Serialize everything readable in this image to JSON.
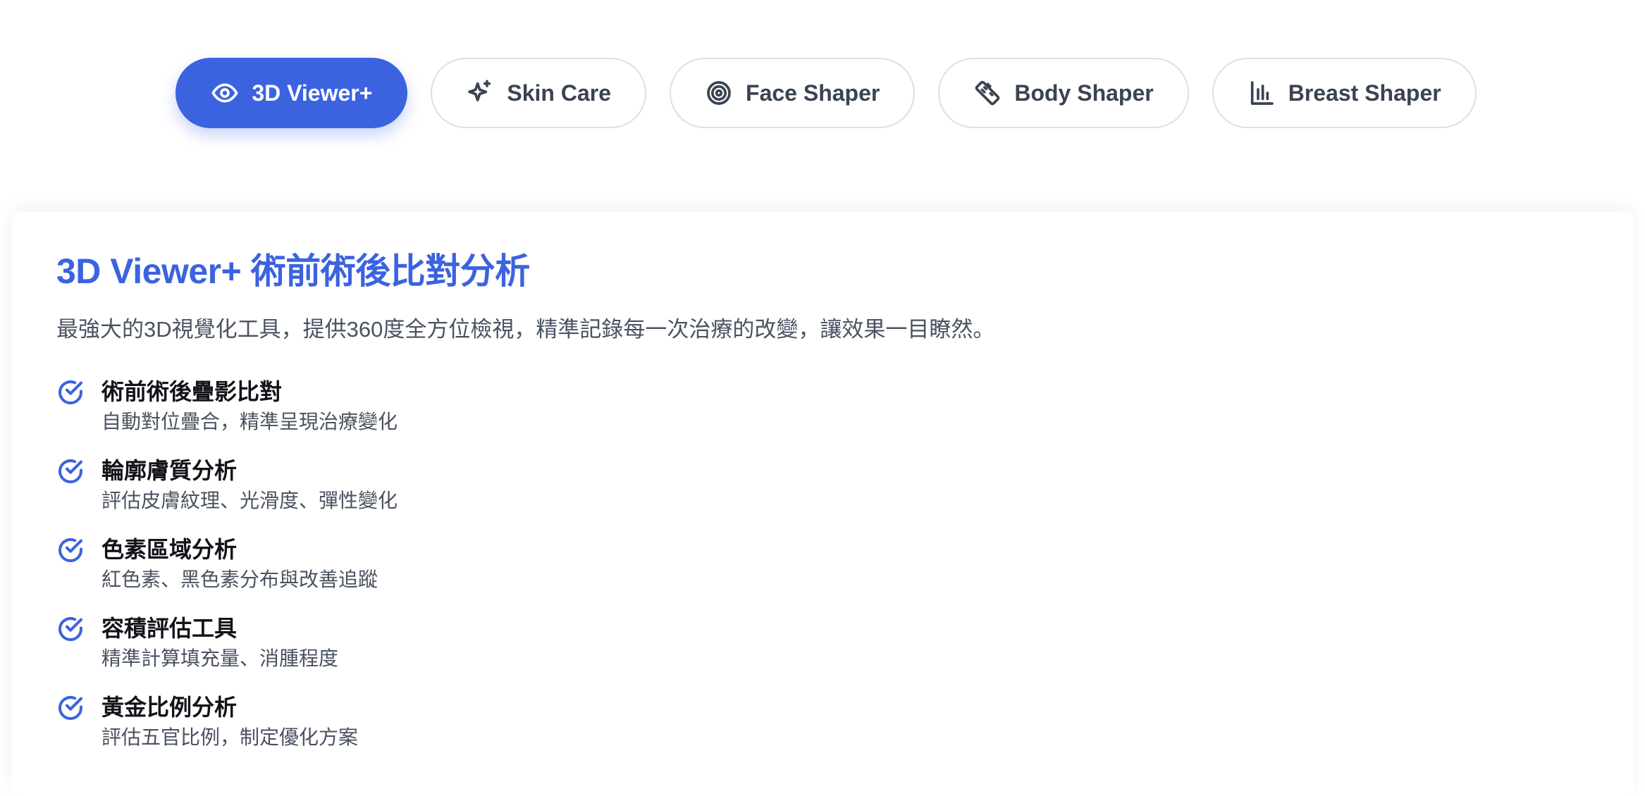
{
  "tabs": [
    {
      "label": "3D Viewer+",
      "icon": "eye-icon",
      "active": true
    },
    {
      "label": "Skin Care",
      "icon": "sparkles-icon",
      "active": false
    },
    {
      "label": "Face Shaper",
      "icon": "target-icon",
      "active": false
    },
    {
      "label": "Body Shaper",
      "icon": "ruler-icon",
      "active": false
    },
    {
      "label": "Breast Shaper",
      "icon": "bar-chart-icon",
      "active": false
    }
  ],
  "panel": {
    "title": "3D Viewer+ 術前術後比對分析",
    "description": "最強大的3D視覺化工具，提供360度全方位檢視，精準記錄每一次治療的改變，讓效果一目瞭然。",
    "features": [
      {
        "title": "術前術後疊影比對",
        "desc": "自動對位疊合，精準呈現治療變化"
      },
      {
        "title": "輪廓膚質分析",
        "desc": "評估皮膚紋理、光滑度、彈性變化"
      },
      {
        "title": "色素區域分析",
        "desc": "紅色素、黑色素分布與改善追蹤"
      },
      {
        "title": "容積評估工具",
        "desc": "精準計算填充量、消腫程度"
      },
      {
        "title": "黃金比例分析",
        "desc": "評估五官比例，制定優化方案"
      }
    ]
  },
  "colors": {
    "accent": "#3b63e0",
    "text": "#111318",
    "muted": "#4a5261",
    "border": "#dcdfe4"
  }
}
